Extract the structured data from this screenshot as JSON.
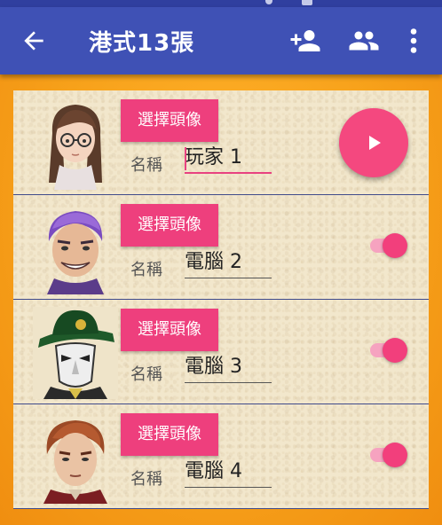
{
  "app_bar": {
    "title": "港式13張",
    "back_icon": "arrow-back-icon",
    "actions": [
      "person-add-icon",
      "group-icon",
      "more-vert-icon"
    ]
  },
  "players": [
    {
      "choose_label": "選擇頭像",
      "name_label": "名稱",
      "name_value": "玩家 1",
      "avatar": "girl-with-glasses-avatar",
      "control": "play-fab"
    },
    {
      "choose_label": "選擇頭像",
      "name_label": "名稱",
      "name_value": "電腦 2",
      "avatar": "purple-hair-man-avatar",
      "control": "switch",
      "enabled": true
    },
    {
      "choose_label": "選擇頭像",
      "name_label": "名稱",
      "name_value": "電腦 3",
      "avatar": "masked-man-avatar",
      "control": "switch",
      "enabled": true
    },
    {
      "choose_label": "選擇頭像",
      "name_label": "名稱",
      "name_value": "電腦 4",
      "avatar": "auburn-hair-man-avatar",
      "control": "switch",
      "enabled": true
    }
  ],
  "colors": {
    "primary": "#3f51b5",
    "accent": "#ee3f7d",
    "background": "#f39a16"
  }
}
